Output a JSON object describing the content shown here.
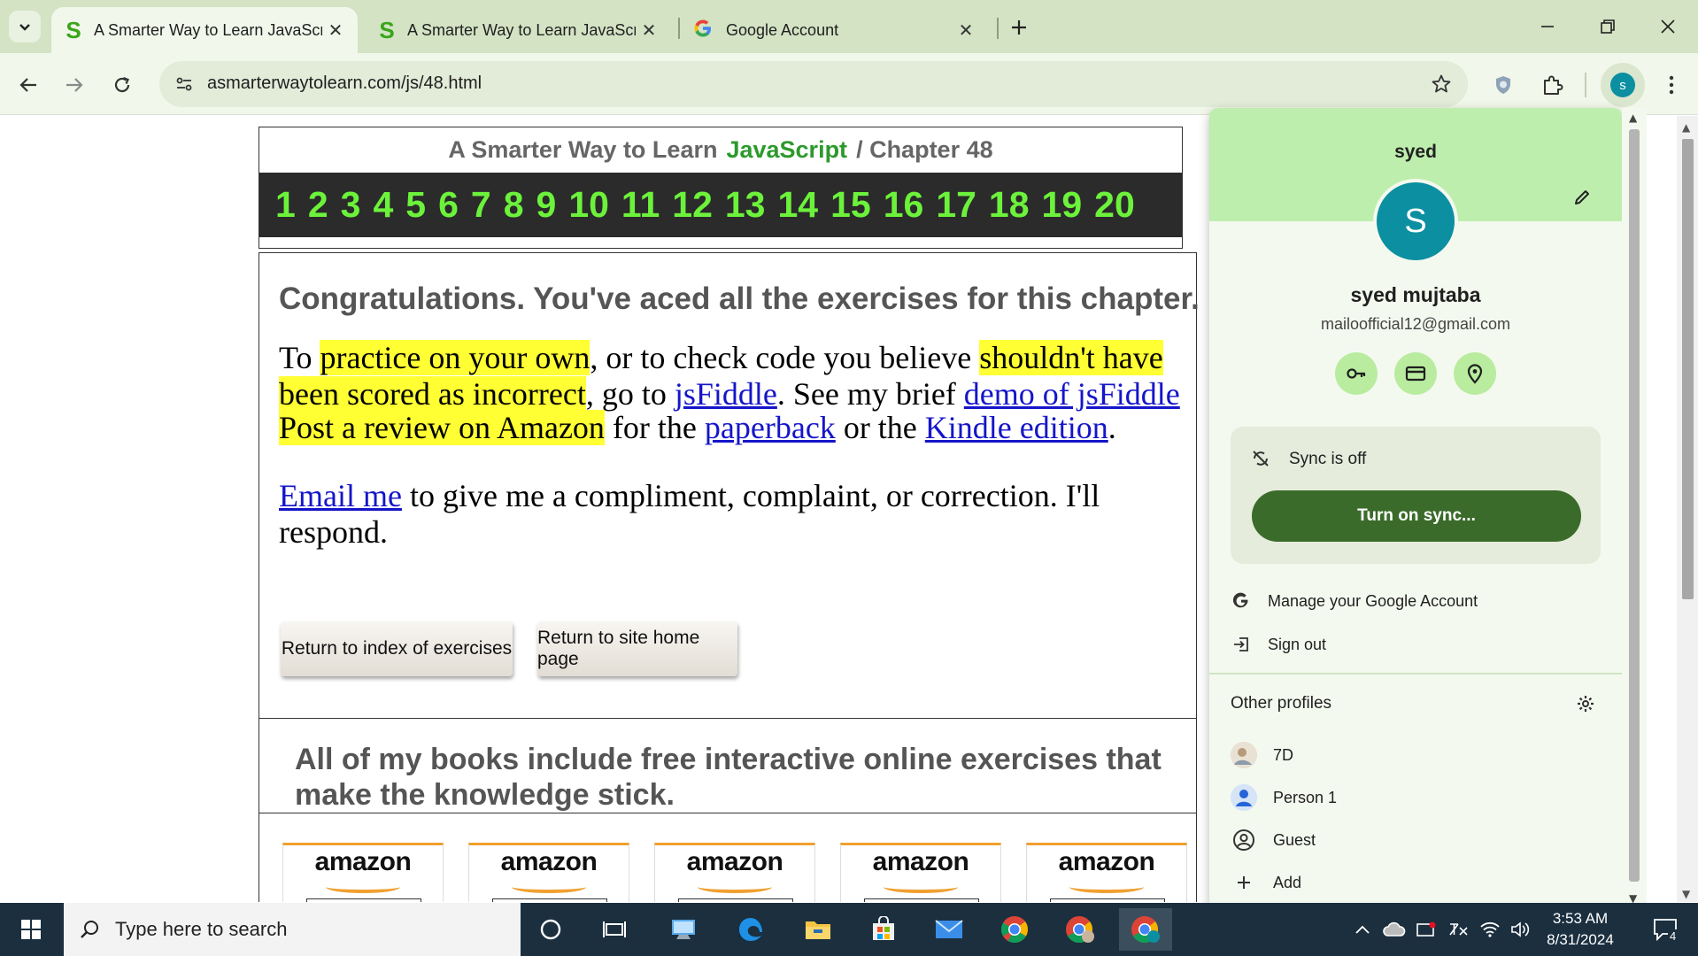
{
  "tabs": [
    {
      "title": "A Smarter Way to Learn JavaScr",
      "favicon": "S"
    },
    {
      "title": "A Smarter Way to Learn JavaScr",
      "favicon": "S"
    },
    {
      "title": "Google Account",
      "favicon": "google-g"
    }
  ],
  "toolbar": {
    "url": "asmarterwaytolearn.com/js/48.html"
  },
  "page": {
    "header": {
      "prefix": "A Smarter Way to Learn",
      "js": "JavaScript",
      "suffix": "/  Chapter 48",
      "chapters": [
        "1",
        "2",
        "3",
        "4",
        "5",
        "6",
        "7",
        "8",
        "9",
        "10",
        "11",
        "12",
        "13",
        "14",
        "15",
        "16",
        "17",
        "18",
        "19",
        "20"
      ]
    },
    "congrats": "Congratulations. You've aced all the exercises for this chapter.",
    "p1": {
      "a": "To ",
      "b": "practice on your own",
      "c": ", or to check code you believe ",
      "d": "shouldn't have",
      "e": "been scored as incorrect",
      "f": ", go to ",
      "g": "jsFiddle",
      "h": ". See my brief ",
      "i": "demo of jsFiddle"
    },
    "p2": {
      "a": "Post a review on Amazon",
      "b": " for the ",
      "c": "paperback",
      "d": " or the ",
      "e": "Kindle edition",
      "f": "."
    },
    "p3": {
      "a": "Email me",
      "b": " to give me a compliment, complaint, or correction. I'll",
      "c": "respond."
    },
    "buttons": {
      "index": "Return to index of exercises",
      "home": "Return to site home page"
    },
    "books_heading": "All of my books include free interactive online exercises that make the knowledge stick.",
    "amazon_word": "amazon"
  },
  "profile_menu": {
    "short_name": "syed",
    "avatar_letter": "S",
    "full_name": "syed mujtaba",
    "email": "mailoofficial12@gmail.com",
    "sync_status": "Sync is off",
    "sync_button": "Turn on sync...",
    "manage_account": "Manage your Google Account",
    "sign_out": "Sign out",
    "other_profiles_label": "Other profiles",
    "profiles": [
      {
        "name": "7D"
      },
      {
        "name": "Person 1"
      },
      {
        "name": "Guest"
      },
      {
        "name": "Add"
      }
    ]
  },
  "taskbar": {
    "search_placeholder": "Type here to search",
    "time": "3:53 AM",
    "date": "8/31/2024",
    "notification_count": "4"
  },
  "colors": {
    "tab_strip": "#d3e3c4",
    "toolbar": "#f1f7ea",
    "highlight": "#ffff33",
    "chapter_digits": "#6cf23b",
    "sync_button": "#3a6b2a",
    "avatar": "#0b8fa1"
  }
}
